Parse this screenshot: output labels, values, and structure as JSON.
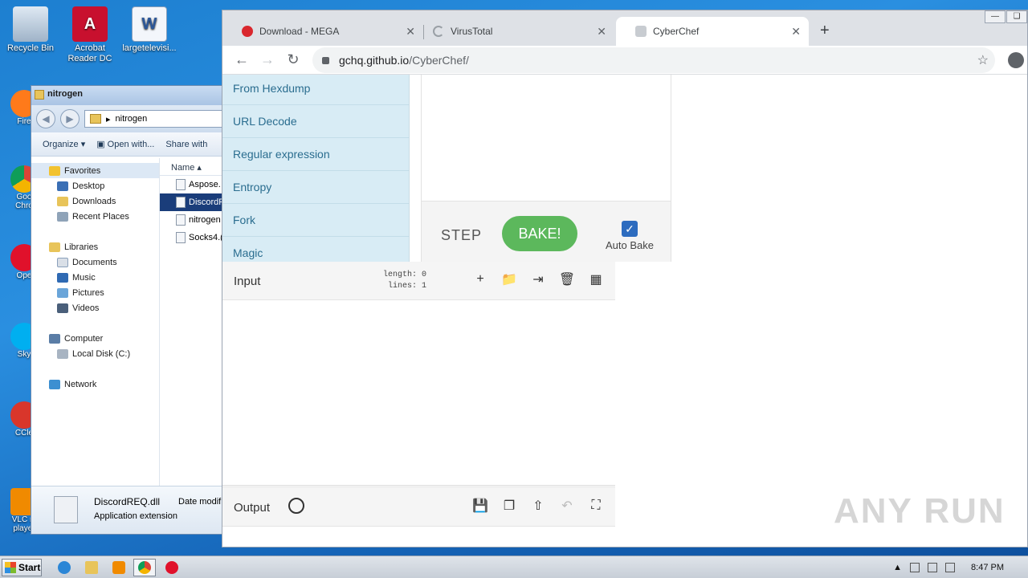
{
  "desktop": {
    "icons": [
      {
        "label": "Recycle Bin"
      },
      {
        "label": "Acrobat Reader DC"
      },
      {
        "label": "largetelevisi..."
      }
    ],
    "side_icons": [
      {
        "label": "Fire"
      },
      {
        "label": "Goo Chro"
      },
      {
        "label": "Ope"
      },
      {
        "label": "Sky"
      },
      {
        "label": "CCle"
      },
      {
        "label": "VLC m player"
      }
    ]
  },
  "explorer": {
    "title": "nitrogen",
    "address": "nitrogen",
    "toolbar": {
      "organize": "Organize",
      "open_with": "Open with...",
      "share_with": "Share with"
    },
    "nav": [
      {
        "label": "Favorites",
        "level": 1
      },
      {
        "label": "Desktop",
        "level": 2
      },
      {
        "label": "Downloads",
        "level": 2
      },
      {
        "label": "Recent Places",
        "level": 2
      },
      {
        "label": "Libraries",
        "level": 1
      },
      {
        "label": "Documents",
        "level": 2
      },
      {
        "label": "Music",
        "level": 2
      },
      {
        "label": "Pictures",
        "level": 2
      },
      {
        "label": "Videos",
        "level": 2
      },
      {
        "label": "Computer",
        "level": 1
      },
      {
        "label": "Local Disk (C:)",
        "level": 2
      },
      {
        "label": "Network",
        "level": 1
      }
    ],
    "column_name": "Name",
    "files": [
      "Aspose.",
      "DiscordR",
      "nitrogen",
      "Socks4.("
    ],
    "selected_file": "DiscordR",
    "details": {
      "name": "DiscordREQ.dll",
      "type": "Application extension",
      "date_label": "Date modifi"
    }
  },
  "browser": {
    "tabs": [
      {
        "title": "Download - MEGA",
        "active": false
      },
      {
        "title": "VirusTotal",
        "active": false
      },
      {
        "title": "CyberChef",
        "active": true
      }
    ],
    "url_host": "gchq.github.io",
    "url_path": "/CyberChef/"
  },
  "cyberchef": {
    "operations": [
      "From Hexdump",
      "URL Decode",
      "Regular expression",
      "Entropy",
      "Fork",
      "Magic"
    ],
    "step_label": "STEP",
    "bake_label": "BAKE!",
    "autobake_label": "Auto Bake",
    "autobake_checked": true,
    "input": {
      "title": "Input",
      "length_label": "length:",
      "length": "0",
      "lines_label": "lines:",
      "lines": "1"
    },
    "output": {
      "title": "Output"
    }
  },
  "taskbar": {
    "start_label": "Start",
    "clock": "8:47 PM"
  },
  "watermark": "ANY RUN",
  "colors": {
    "bake": "#5cb85c",
    "ops_bg": "#d8ecf5",
    "selected_file": "#1a3d7a"
  }
}
